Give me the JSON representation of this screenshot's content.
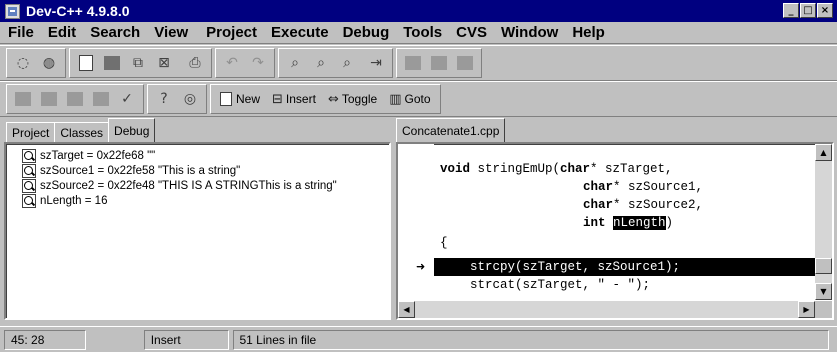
{
  "window": {
    "title": "Dev-C++ 4.9.8.0",
    "btn_min": "_",
    "btn_max": "□",
    "btn_close": "×"
  },
  "menu": [
    "File",
    "Edit",
    "Search",
    "View",
    "Project",
    "Execute",
    "Debug",
    "Tools",
    "CVS",
    "Window",
    "Help"
  ],
  "toolbar2": {
    "new_label": "New",
    "insert_label": "Insert",
    "toggle_label": "Toggle",
    "goto_label": "Goto",
    "insert_icon": "insert-icon",
    "toggle_icon": "toggle-bookmark-icon",
    "goto_icon": "goto-icon"
  },
  "left_tabs": [
    "Project",
    "Classes",
    "Debug"
  ],
  "debug_watches": [
    "szTarget = 0x22fe68 \"\"",
    "szSource1 = 0x22fe58 \"This is a string\"",
    "szSource2 = 0x22fe48 \"THIS IS A STRINGThis is a string\"",
    "nLength = 16"
  ],
  "editor": {
    "tab": "Concatenate1.cpp",
    "line1_kw": "void",
    "line1_rest": " stringEmUp(",
    "line1_kw2": "char",
    "line1_end": "* szTarget,",
    "line2_kw": "char",
    "line2_end": "* szSource1,",
    "line3_kw": "char",
    "line3_end": "* szSource2,",
    "line4_kw": "int",
    "line4_sel": "nLength",
    "line4_end": ")",
    "line5": "{",
    "line6": "    strcpy(szTarget, szSource1);",
    "line7": "    strcat(szTarget, \" - \");",
    "exec_marker": "➜"
  },
  "status": {
    "position": "45: 28",
    "mode": "Insert",
    "lines": "51 Lines in file"
  }
}
